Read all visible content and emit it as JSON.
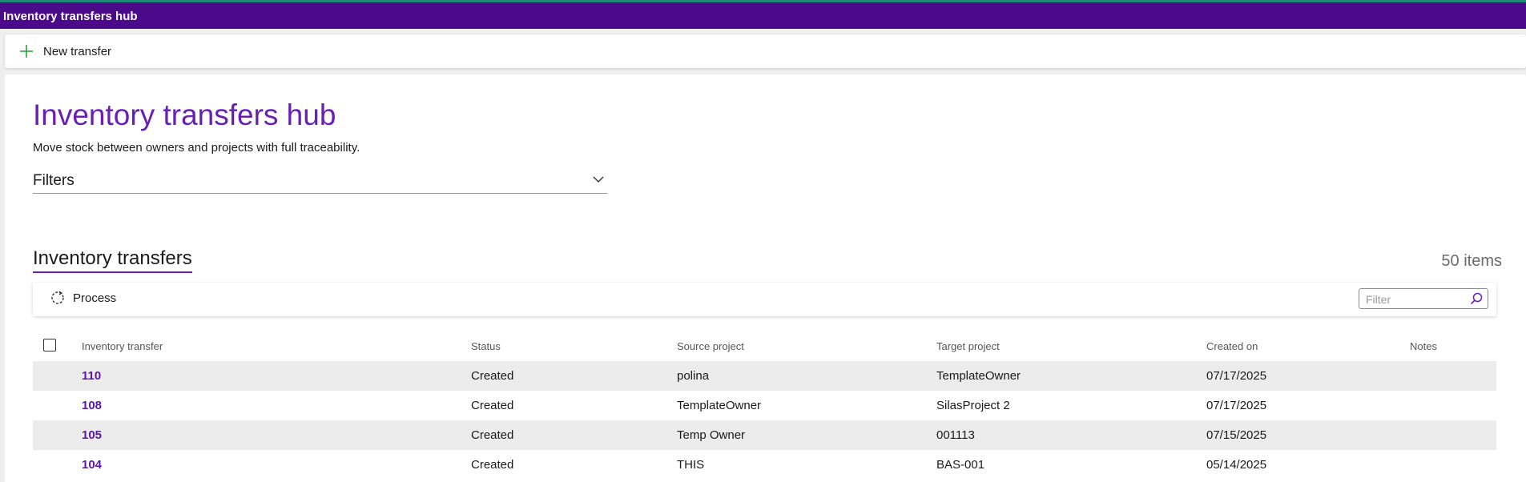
{
  "app": {
    "title": "Inventory transfers hub"
  },
  "commandbar": {
    "new_label": "New transfer",
    "new_icon": "plus-icon"
  },
  "page": {
    "title": "Inventory transfers hub",
    "subtitle": "Move stock between owners and projects with full traceability.",
    "filters_label": "Filters"
  },
  "section": {
    "title": "Inventory transfers",
    "count": "50 items"
  },
  "toolbar": {
    "process_label": "Process",
    "filter_placeholder": "Filter"
  },
  "table": {
    "columns": [
      "Inventory transfer",
      "Status",
      "Source project",
      "Target project",
      "Created on",
      "Notes"
    ],
    "rows": [
      {
        "id": "110",
        "status": "Created",
        "source": "polina",
        "target": "TemplateOwner",
        "created": "07/17/2025",
        "notes": ""
      },
      {
        "id": "108",
        "status": "Created",
        "source": "TemplateOwner",
        "target": "SilasProject 2",
        "created": "07/17/2025",
        "notes": ""
      },
      {
        "id": "105",
        "status": "Created",
        "source": "Temp Owner",
        "target": "001113",
        "created": "07/15/2025",
        "notes": ""
      },
      {
        "id": "104",
        "status": "Created",
        "source": "THIS",
        "target": "BAS-001",
        "created": "05/14/2025",
        "notes": ""
      }
    ]
  },
  "colors": {
    "brand": "#4b0a8a",
    "accent": "#6a1fb3",
    "link": "#5a16a8",
    "plus": "#2e9e3e"
  }
}
